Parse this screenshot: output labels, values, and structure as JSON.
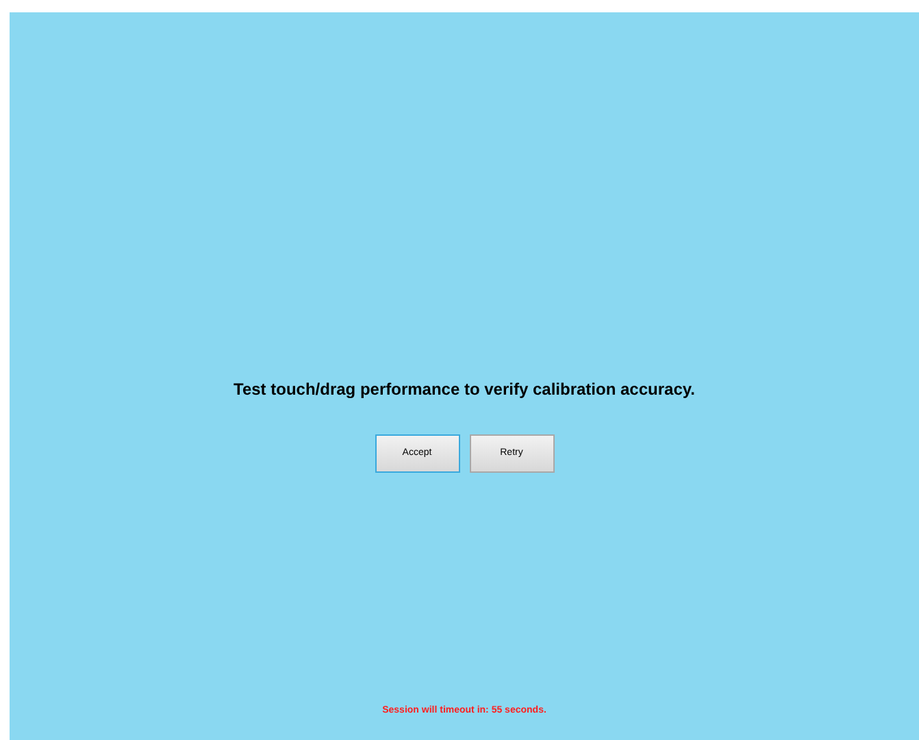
{
  "prompt": "Test touch/drag performance to verify calibration accuracy.",
  "buttons": [
    {
      "label": "Accept",
      "focused": true
    },
    {
      "label": "Retry",
      "focused": false
    }
  ],
  "status": "Session will timeout in: 55 seconds."
}
